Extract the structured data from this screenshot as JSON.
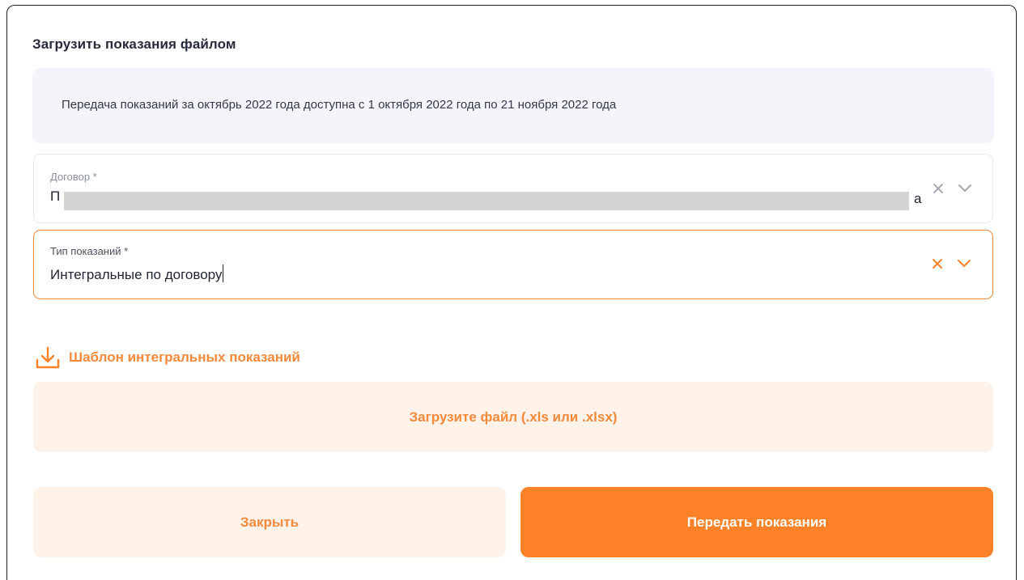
{
  "dialog": {
    "title": "Загрузить показания файлом",
    "notice": "Передача показаний за октябрь 2022 года доступна с 1 октября 2022 года по 21 ноября 2022 года"
  },
  "contract_field": {
    "label": "Договор *",
    "value_visible_start": "П",
    "value_visible_end": "а",
    "clear_icon": "close-icon",
    "dropdown_icon": "chevron-down-icon"
  },
  "reading_type_field": {
    "label": "Тип показаний *",
    "value": "Интегральные по договору",
    "clear_icon": "close-icon",
    "dropdown_icon": "chevron-down-icon"
  },
  "template_link": {
    "icon": "download-icon",
    "label": "Шаблон интегральных показаний"
  },
  "upload_area": {
    "label": "Загрузите файл (.xls или .xlsx)"
  },
  "buttons": {
    "close": "Закрыть",
    "submit": "Передать показания"
  },
  "colors": {
    "accent": "#fd8227",
    "accent_light": "#fef2e9",
    "notice_bg": "#f3f5fa",
    "muted_icon": "#9aa0ad"
  }
}
